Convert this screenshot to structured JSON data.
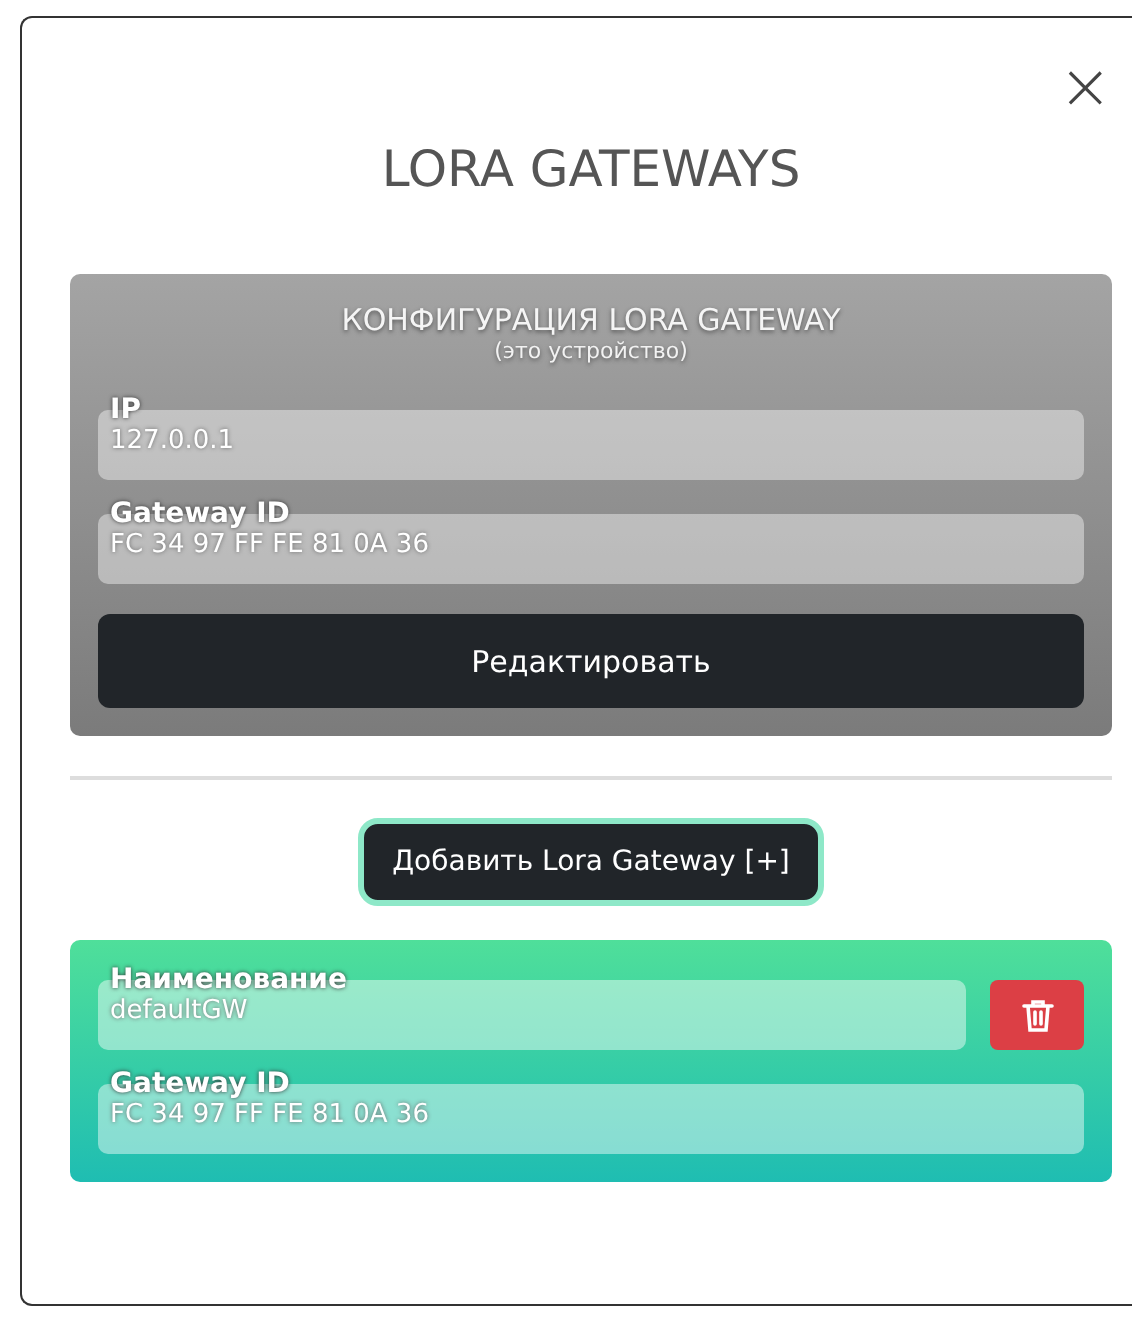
{
  "dialog": {
    "title": "LORA GATEWAYS",
    "close": "×"
  },
  "config": {
    "title": "КОНФИГУРАЦИЯ LORA GATEWAY",
    "subtitle": "(это устройство)",
    "fields": [
      {
        "label": "IP",
        "value": "127.0.0.1"
      },
      {
        "label": "Gateway ID",
        "value": "FC 34 97 FF FE 81 0A 36"
      }
    ],
    "button": "Редактировать"
  },
  "add_button": "Добавить Lora Gateway [+]",
  "gateways": [
    {
      "fields": [
        {
          "label": "Наименование",
          "value": "defaultGW"
        },
        {
          "label": "Gateway ID",
          "value": "FC 34 97 FF FE 81 0A 36"
        }
      ]
    }
  ]
}
